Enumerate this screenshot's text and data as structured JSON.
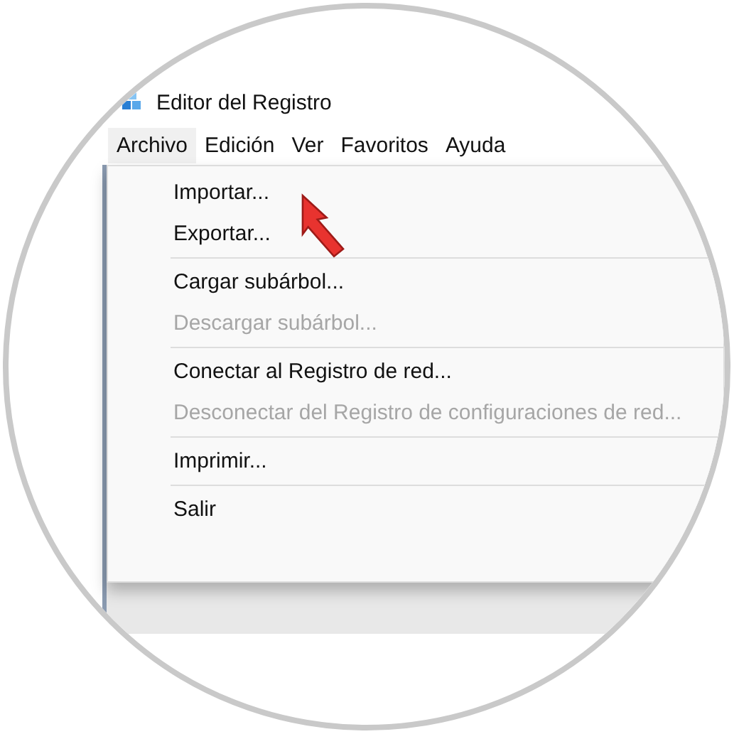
{
  "window": {
    "title": "Editor del Registro"
  },
  "menubar": [
    {
      "label": "Archivo",
      "selected": true
    },
    {
      "label": "Edición",
      "selected": false
    },
    {
      "label": "Ver",
      "selected": false
    },
    {
      "label": "Favoritos",
      "selected": false
    },
    {
      "label": "Ayuda",
      "selected": false
    }
  ],
  "menu": [
    {
      "kind": "item",
      "label": "Importar...",
      "disabled": false
    },
    {
      "kind": "item",
      "label": "Exportar...",
      "disabled": false
    },
    {
      "kind": "separator"
    },
    {
      "kind": "item",
      "label": "Cargar subárbol...",
      "disabled": false
    },
    {
      "kind": "item",
      "label": "Descargar subárbol...",
      "disabled": true
    },
    {
      "kind": "separator"
    },
    {
      "kind": "item",
      "label": "Conectar al Registro de red...",
      "disabled": false
    },
    {
      "kind": "item",
      "label": "Desconectar del Registro de configuraciones de red...",
      "disabled": true
    },
    {
      "kind": "separator"
    },
    {
      "kind": "item",
      "label": "Imprimir...",
      "disabled": false
    },
    {
      "kind": "separator"
    },
    {
      "kind": "item",
      "label": "Salir",
      "disabled": false
    }
  ]
}
